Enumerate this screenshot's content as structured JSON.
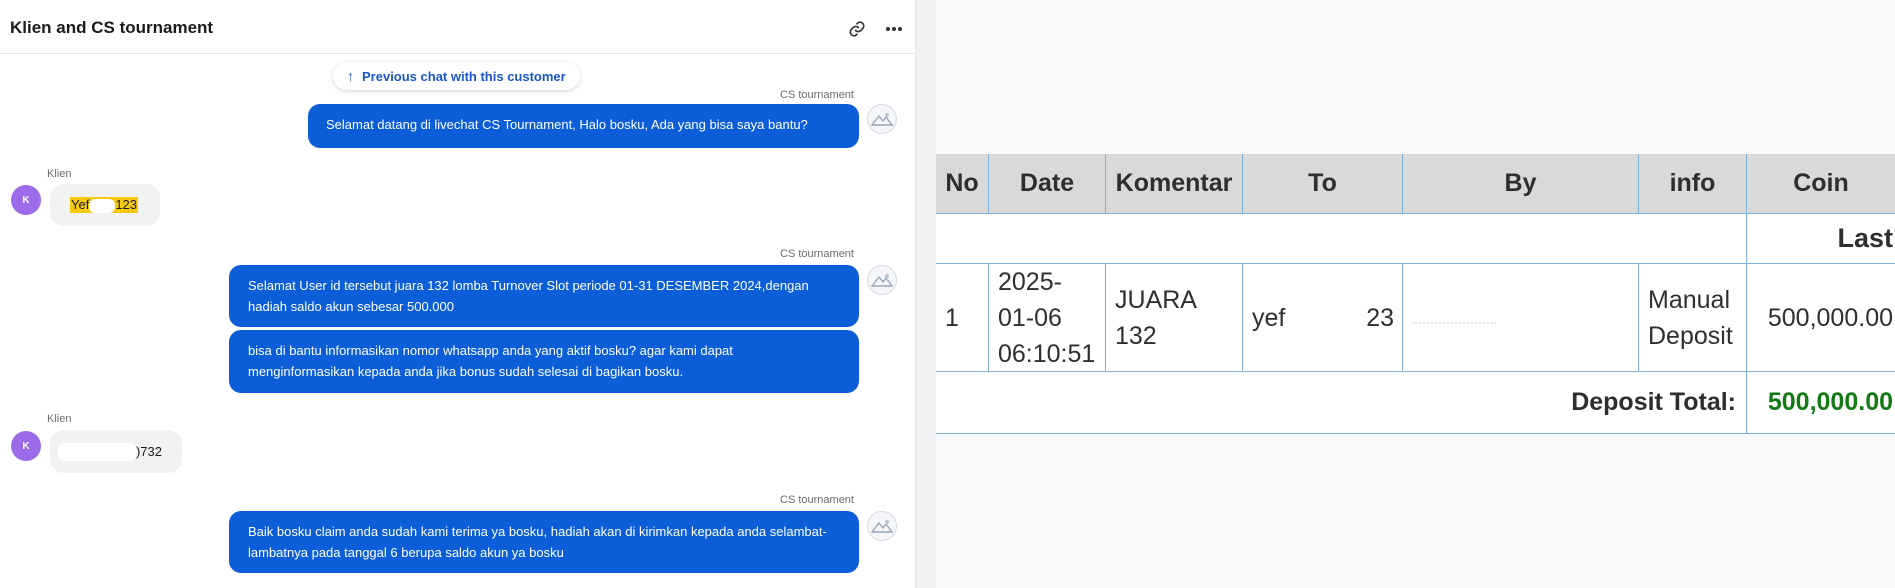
{
  "chat": {
    "title": "Klien and CS tournament",
    "prev_chat_label": "Previous chat with this customer",
    "avatar_initial": "K",
    "messages": [
      {
        "author": "CS tournament",
        "text": "Selamat datang di livechat CS Tournament, Halo bosku, Ada yang bisa saya bantu?"
      },
      {
        "author": "Klien",
        "text_start": "Yef",
        "text_end": "123"
      },
      {
        "author": "CS tournament",
        "text": "Selamat User id tersebut juara 132 lomba Turnover Slot periode 01-31 DESEMBER 2024,dengan hadiah saldo akun sebesar 500.000"
      },
      {
        "text": "bisa di bantu informasikan nomor whatsapp anda yang aktif bosku? agar kami dapat menginformasikan kepada anda jika bonus sudah selesai di bagikan bosku."
      },
      {
        "author": "Klien",
        "text_end": ")732"
      },
      {
        "author": "CS tournament",
        "text": "Baik bosku claim anda sudah kami terima ya bosku, hadiah akan di kirimkan kepada anda selambat-lambatnya pada tanggal 6 berupa saldo akun ya bosku"
      }
    ]
  },
  "table": {
    "headers": [
      "No",
      "Date",
      "Komentar",
      "To",
      "By",
      "info",
      "Coin"
    ],
    "last_label": "Last",
    "row": {
      "no": "1",
      "date_line1": "2025-",
      "date_line2": "01-06",
      "date_line3": "06:10:51",
      "komentar_line1": "JUARA",
      "komentar_line2": "132",
      "to_start": "yef",
      "to_end": "23",
      "info_line1": "Manual",
      "info_line2": "Deposit",
      "coin": "500,000.00"
    },
    "total_label": "Deposit Total:",
    "total_value": "500,000.00"
  },
  "colors": {
    "bubble_out": "#0b5ed7",
    "bubble_in": "#f2f2f2",
    "avatar": "#9b6bea",
    "coin_green": "#1c8c1c",
    "table_border": "#7fb2db",
    "header_bg": "#d9d9d9"
  },
  "icons": [
    "link-icon",
    "more-icon",
    "arrow-up-icon",
    "cs-avatar-icon"
  ]
}
